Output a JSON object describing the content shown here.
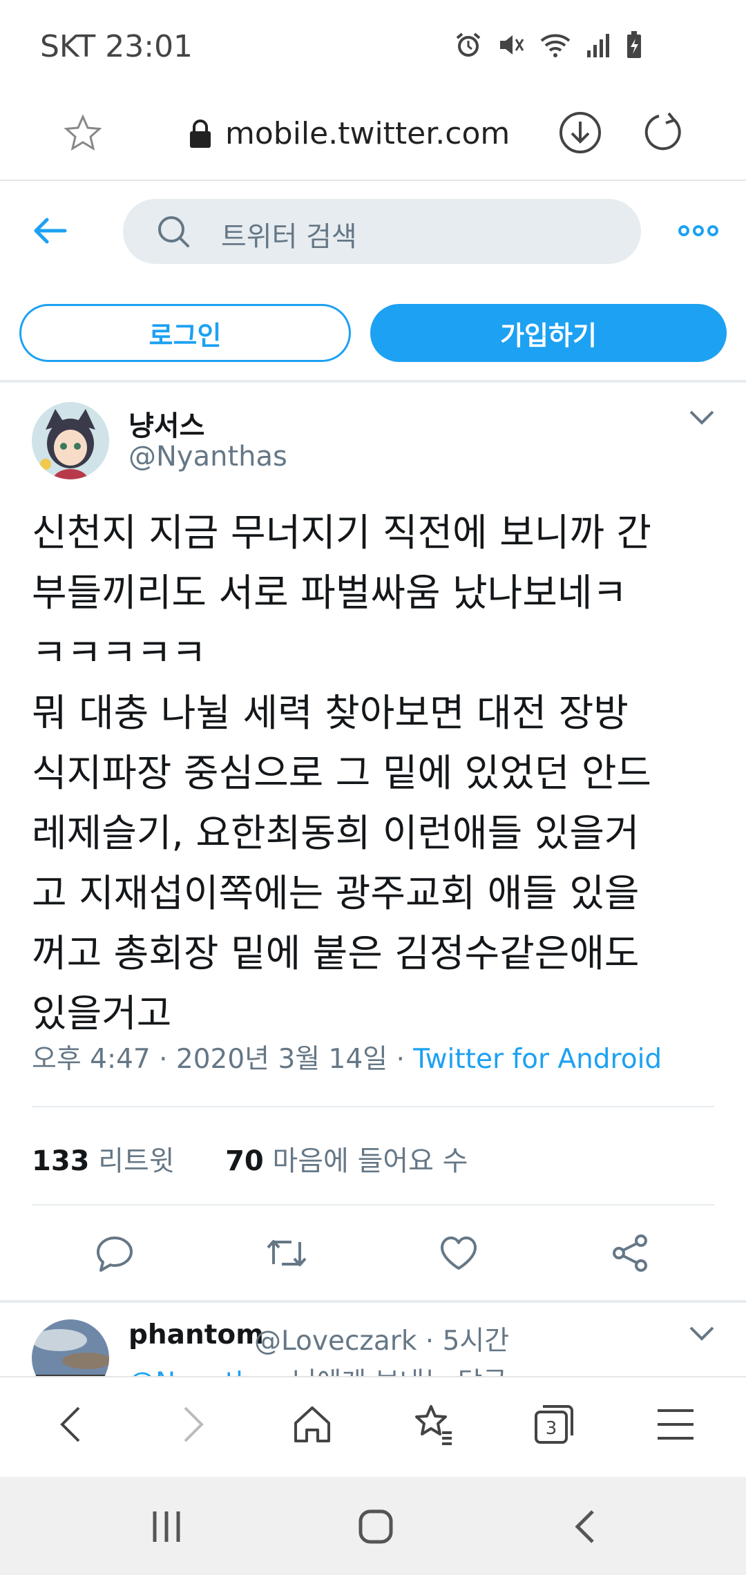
{
  "status_bar": {
    "carrier": "SKT",
    "time": "23:01",
    "icons": [
      "alarm-icon",
      "mute-icon",
      "wifi-icon",
      "signal-icon",
      "battery-charging-icon"
    ]
  },
  "browser": {
    "url": "mobile.twitter.com",
    "icons": [
      "star-icon",
      "lock-icon",
      "download-icon",
      "reload-icon"
    ]
  },
  "twitter_header": {
    "search_placeholder": "트위터 검색"
  },
  "auth": {
    "login_label": "로그인",
    "signup_label": "가입하기"
  },
  "tweet": {
    "author_name": "냥서스",
    "author_handle": "@Nyanthas",
    "text": "신천지 지금 무너지기 직전에 보니까 간\n부들끼리도 서로 파벌싸움 났나보네ㅋ\nㅋㅋㅋㅋㅋ\n뭐 대충 나뉠 세력 찾아보면 대전 장방\n식지파장 중심으로 그 밑에 있었던 안드\n레제슬기, 요한최동희 이런애들 있을거\n고 지재섭이쪽에는 광주교회 애들 있을\n꺼고 총회장 밑에 붙은 김정수같은애도\n있을거고",
    "timestamp": "오후 4:47 · 2020년 3월 14일",
    "separator": " · ",
    "client": "Twitter for Android",
    "retweets_count": "133",
    "retweets_label": "리트윗",
    "likes_count": "70",
    "likes_label": "마음에 들어요 수"
  },
  "reply": {
    "author_name": "phantom",
    "author_handle_time": "@Loveczark · 5시간",
    "mention": "@Nyanthas",
    "text": " 님에게 보내는 답글"
  },
  "colors": {
    "twitter_blue": "#1da1f2",
    "secondary_text": "#657786",
    "search_bg": "#e6ecf0"
  }
}
